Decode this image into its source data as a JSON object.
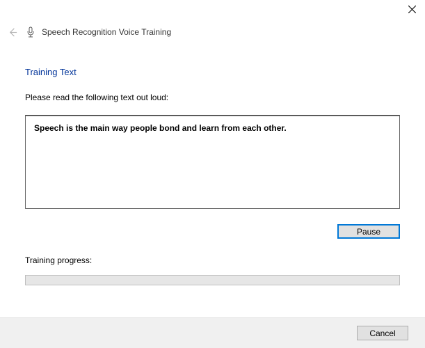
{
  "window": {
    "title": "Speech Recognition Voice Training"
  },
  "page": {
    "heading": "Training Text",
    "instruction": "Please read the following text out loud:",
    "training_text": "Speech is the main way people bond and learn from each other.",
    "pause_label": "Pause",
    "progress_label": "Training progress:"
  },
  "footer": {
    "cancel_label": "Cancel"
  }
}
